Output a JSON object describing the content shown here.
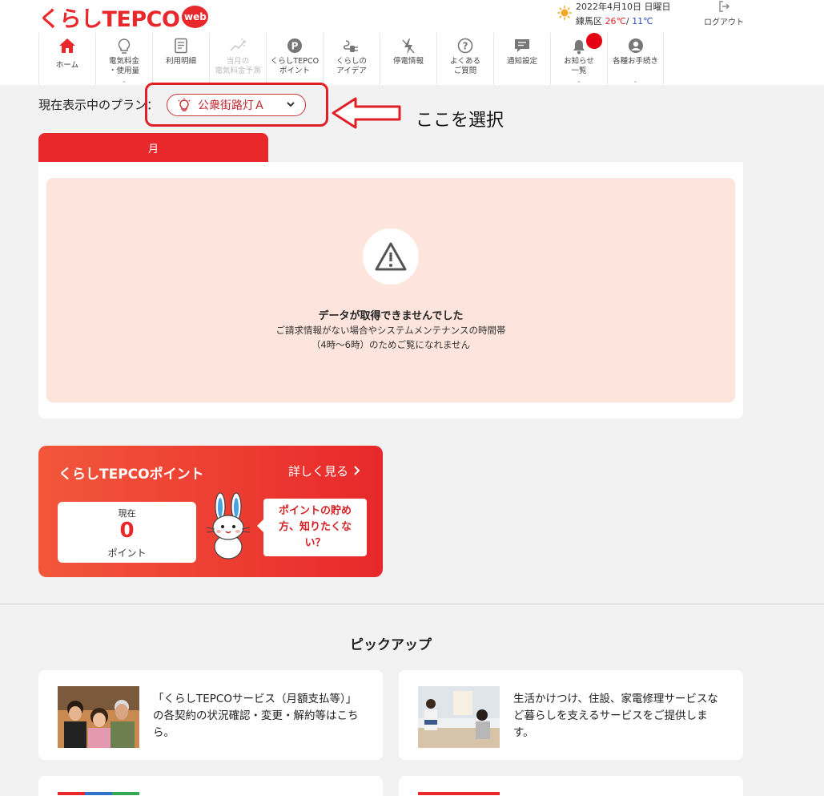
{
  "header": {
    "logo_text": "くらしTEPCO",
    "logo_badge": "web",
    "weather": {
      "date": "2022年4月10日 日曜日",
      "area": "練馬区",
      "high": "26℃",
      "sep": "/",
      "low": "11℃",
      "icon": "sun-icon"
    },
    "logout_label": "ログアウト"
  },
  "nav": [
    {
      "label": "ホーム",
      "icon": "home-icon",
      "active": true
    },
    {
      "label": "電気料金\n・使用量",
      "icon": "lightbulb-icon",
      "chevron": true
    },
    {
      "label": "利用明細",
      "icon": "document-icon"
    },
    {
      "label": "当月の\n電気料金予測",
      "icon": "chart-forecast-icon",
      "disabled": true
    },
    {
      "label": "くらしTEPCO\nポイント",
      "icon": "point-p-icon"
    },
    {
      "label": "くらしの\nアイデア",
      "icon": "plug-icon"
    },
    {
      "label": "停電情報",
      "icon": "lightning-icon"
    },
    {
      "label": "よくある\nご質問",
      "icon": "question-icon"
    },
    {
      "label": "通知設定",
      "icon": "message-icon"
    },
    {
      "label": "お知らせ\n一覧",
      "icon": "bell-icon",
      "chevron": true,
      "badge": true
    },
    {
      "label": "各種お手続き",
      "icon": "user-icon",
      "chevron": true
    }
  ],
  "plan": {
    "label": "現在表示中のプラン：",
    "value": "公衆街路灯Ａ",
    "annotation": "ここを選択"
  },
  "usage": {
    "tab_label": "月",
    "nodata_title": "データが取得できませんでした",
    "nodata_line1": "ご請求情報がない場合やシステムメンテナンスの時間帯",
    "nodata_line2": "（4時〜6時）のためご覧になれません"
  },
  "points": {
    "title": "くらしTEPCOポイント",
    "more": "詳しく見る",
    "current_label": "現在",
    "value": "0",
    "unit": "ポイント",
    "bubble": "ポイントの貯め方、知りたくない？"
  },
  "pickup": {
    "title": "ピックアップ",
    "items": [
      {
        "text": "「くらしTEPCOサービス（月額支払等）」の各契約の状況確認・変更・解約等はこちら。"
      },
      {
        "text": "生活かけつけ、住設、家電修理サービスなど暮らしを支えるサービスをご提供します。"
      }
    ]
  },
  "colors": {
    "brand": "#e8282b",
    "annotation": "#e01f27",
    "nodata_bg": "#fde4dc",
    "page_bg": "#f2f2f2"
  }
}
